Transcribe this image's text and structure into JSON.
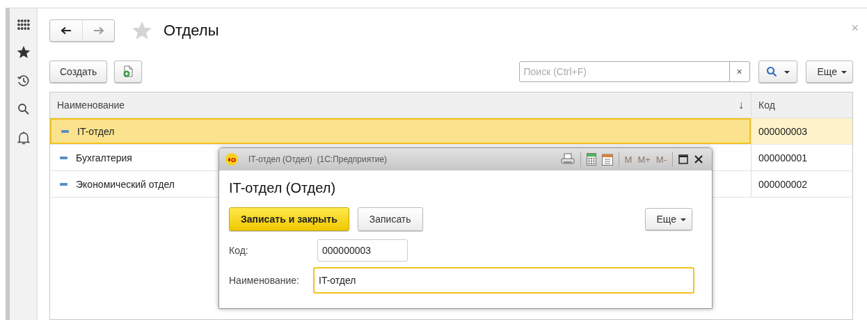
{
  "title": "Отделы",
  "close": "×",
  "toolbar": {
    "create": "Создать",
    "search": {
      "placeholder": "Поиск (Ctrl+F)",
      "clear": "×"
    },
    "more": "Еще"
  },
  "table": {
    "columns": [
      {
        "label": "Наименование",
        "sort": "↓"
      },
      {
        "label": "Код"
      }
    ],
    "rows": [
      {
        "name": "IT-отдел",
        "code": "000000003",
        "selected": true
      },
      {
        "name": "Бухгалтерия",
        "code": "000000001",
        "selected": false
      },
      {
        "name": "Экономический отдел",
        "code": "000000002",
        "selected": false
      }
    ]
  },
  "dialog": {
    "window_title": "IT-отдел (Отдел)  (1С:Предприятие)",
    "memory_buttons": [
      {
        "label": "M",
        "disabled": true
      },
      {
        "label": "M+",
        "disabled": true
      },
      {
        "label": "M-",
        "disabled": true
      }
    ],
    "heading": "IT-отдел (Отдел)",
    "buttons": [
      {
        "label": "Записать и закрыть",
        "kind": "primary"
      },
      {
        "label": "Записать",
        "kind": "default"
      }
    ],
    "more": "Еще",
    "fields": [
      {
        "label": "Код:",
        "value": "000000003",
        "focused": false
      },
      {
        "label": "Наименование:",
        "value": "IT-отдел",
        "focused": true
      }
    ]
  }
}
